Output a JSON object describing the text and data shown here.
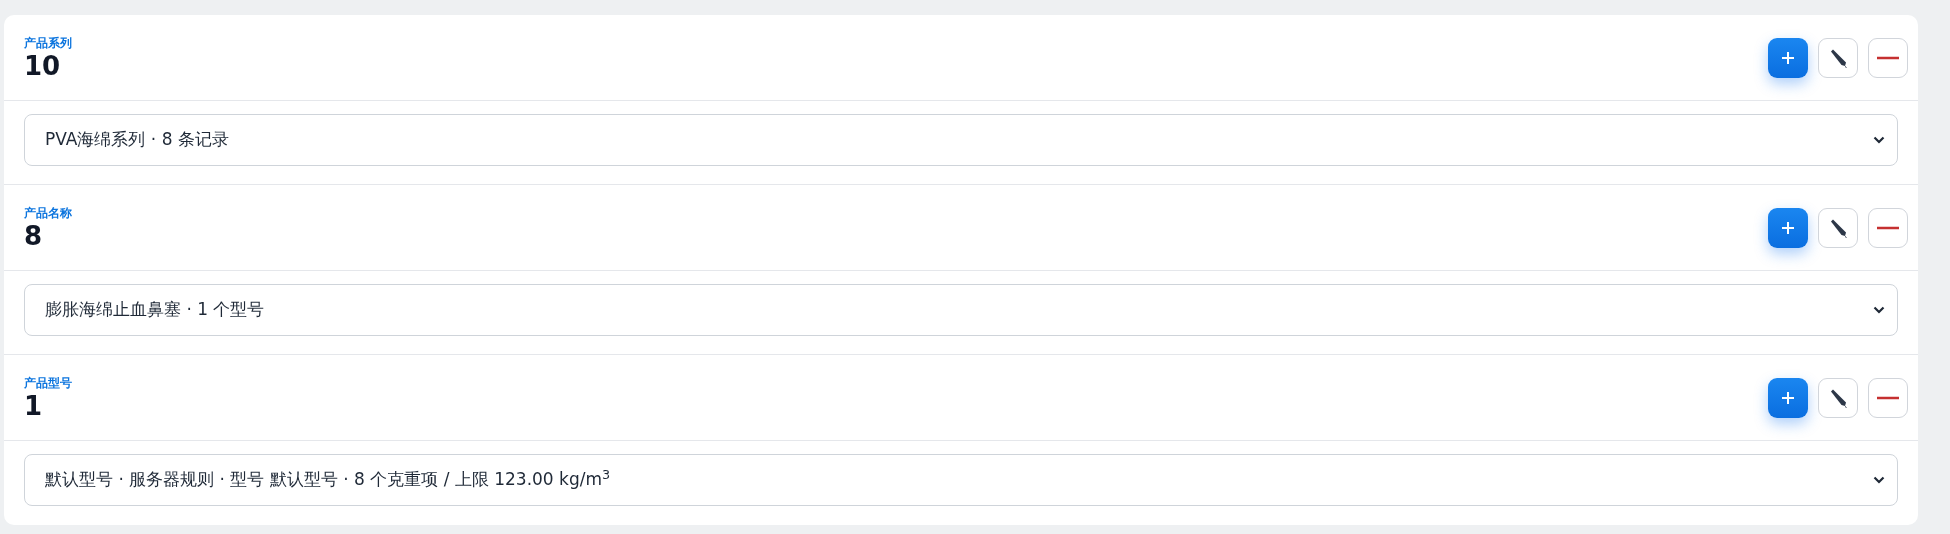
{
  "sections": [
    {
      "label": "产品系列",
      "count": "10",
      "select_value": "PVA海绵系列 · 8 条记录"
    },
    {
      "label": "产品名称",
      "count": "8",
      "select_value": "膨胀海绵止血鼻塞 · 1 个型号"
    },
    {
      "label": "产品型号",
      "count": "1",
      "select_value": "默认型号 · 服务器规则 · 型号 默认型号 · 8 个克重项 / 上限 123.00 kg/m$^{3}$"
    }
  ]
}
